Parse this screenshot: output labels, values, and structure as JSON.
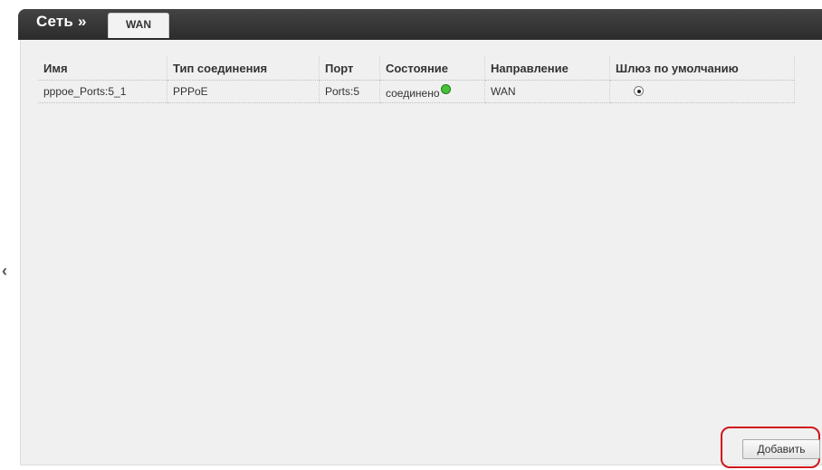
{
  "header": {
    "section_title": "Сеть »",
    "tab_label": "WAN"
  },
  "table": {
    "headers": [
      "Имя",
      "Тип соединения",
      "Порт",
      "Состояние",
      "Направление",
      "Шлюз по умолчанию"
    ],
    "rows": [
      {
        "name": "pppoe_Ports:5_1",
        "type": "PPPoE",
        "port": "Ports:5",
        "state": "соединено",
        "direction": "WAN",
        "default_gateway_selected": true
      }
    ]
  },
  "status_color": "#46c23a",
  "highlight_color": "#d0161c",
  "icons": {
    "nav": "chevron-left-icon",
    "status": "status-dot-icon",
    "gateway": "radio-button"
  },
  "actions": {
    "add_label": "Добавить"
  }
}
